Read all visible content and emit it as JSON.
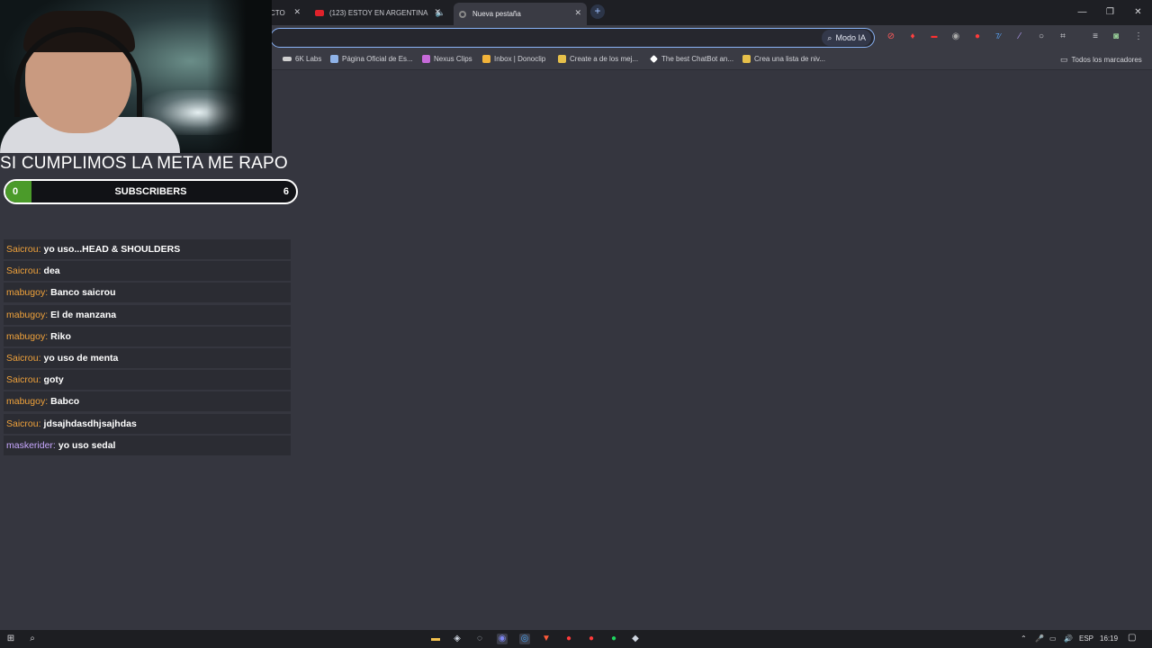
{
  "browser": {
    "tabs": [
      {
        "label": "CTO"
      },
      {
        "label": "(123) ESTOY EN ARGENTINA",
        "audio_icon": "speaker-icon"
      },
      {
        "label": "Nueva pestaña"
      }
    ],
    "new_tab_label": "+",
    "window_controls": {
      "minimize": "—",
      "restore": "❐",
      "close": "✕"
    },
    "omnibox": {
      "ai_mode_label": "Modo IA",
      "value": ""
    },
    "bookmarks": [
      {
        "label": "6K Labs",
        "icon": "labs-icon",
        "color": "#d0d0d0"
      },
      {
        "label": "Página Oficial de Es...",
        "icon": "bird-icon",
        "color": "#8fb3e8"
      },
      {
        "label": "Nexus Clips",
        "icon": "clips-icon",
        "color": "#c66ad9"
      },
      {
        "label": "Inbox | Donoclip",
        "icon": "donoclip-icon",
        "color": "#f2b33a"
      },
      {
        "label": "Create a de los mej...",
        "icon": "tier-icon",
        "color": "#e6c04a"
      },
      {
        "label": "The best ChatBot an...",
        "icon": "chatbot-icon",
        "color": "#ffffff"
      },
      {
        "label": "Crea una lista de niv...",
        "icon": "tier-icon",
        "color": "#e6c04a"
      }
    ],
    "all_bookmarks_label": "Todos los marcadores"
  },
  "overlay": {
    "goal_title": "SI CUMPLIMOS LA META ME RAPO",
    "goal_label": "SUBSCRIBERS",
    "goal_current": "0",
    "goal_target": "6",
    "goal_progress": 0.09,
    "goal_color": "#4b9b2a"
  },
  "chat": [
    {
      "user": "Saicrou:",
      "message": "yo uso...HEAD & SHOULDERS"
    },
    {
      "user": "Saicrou:",
      "message": "dea"
    },
    {
      "user": "mabugoy:",
      "message": "Banco saicrou"
    },
    {
      "user": "mabugoy:",
      "message": "El de manzana"
    },
    {
      "user": "mabugoy:",
      "message": "Riko"
    },
    {
      "user": "Saicrou:",
      "message": "yo uso de menta"
    },
    {
      "user": "Saicrou:",
      "message": "goty"
    },
    {
      "user": "mabugoy:",
      "message": "Babco"
    },
    {
      "user": "Saicrou:",
      "message": "jdsajhdasdhjsajhdas"
    },
    {
      "user": "maskerider:",
      "message": "yo uso sedal"
    }
  ],
  "taskbar": {
    "language": "ESP",
    "time": "16:19"
  }
}
